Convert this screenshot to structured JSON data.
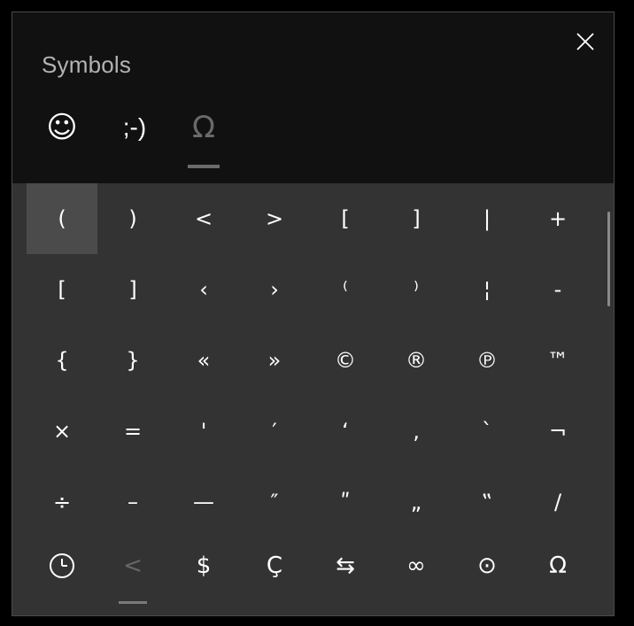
{
  "window": {
    "title": "Symbols"
  },
  "tabs": [
    {
      "label": "☺",
      "icon": "smiley-face-icon",
      "active": false
    },
    {
      "label": ";-)",
      "icon": "kaomoji-icon",
      "active": false
    },
    {
      "label": "Ω",
      "icon": "omega-symbol-icon",
      "active": true
    }
  ],
  "grid": {
    "rows": [
      [
        "(",
        ")",
        "<",
        ">",
        "[",
        "]",
        "|",
        "+"
      ],
      [
        "[",
        "]",
        "‹",
        "›",
        "⁽",
        "⁾",
        "¦",
        "-"
      ],
      [
        "{",
        "}",
        "«",
        "»",
        "©",
        "®",
        "℗",
        "™"
      ],
      [
        "×",
        "=",
        "'",
        "′",
        "ʻ",
        "‚",
        "`",
        "¬"
      ],
      [
        "÷",
        "–",
        "—",
        "″",
        "ʺ",
        "„",
        "‟",
        "/"
      ]
    ],
    "selected": [
      0,
      0
    ]
  },
  "categories": [
    {
      "label": "",
      "icon": "clock-icon",
      "active": false
    },
    {
      "label": "<",
      "icon": "brackets-category-icon",
      "active": true
    },
    {
      "label": "$",
      "icon": "currency-icon",
      "active": false
    },
    {
      "label": "Ç",
      "icon": "latin-letters-icon",
      "active": false
    },
    {
      "label": "⇆",
      "icon": "arrows-icon",
      "active": false
    },
    {
      "label": "∞",
      "icon": "math-icon",
      "active": false
    },
    {
      "label": "⊙",
      "icon": "geometric-icon",
      "active": false
    },
    {
      "label": "Ω",
      "icon": "language-icon",
      "active": false
    }
  ],
  "colors": {
    "header_bg": "#111111",
    "panel_bg": "#333333",
    "selected_cell": "#4b4b4b",
    "text": "#ffffff",
    "muted": "#b3b3b3"
  }
}
